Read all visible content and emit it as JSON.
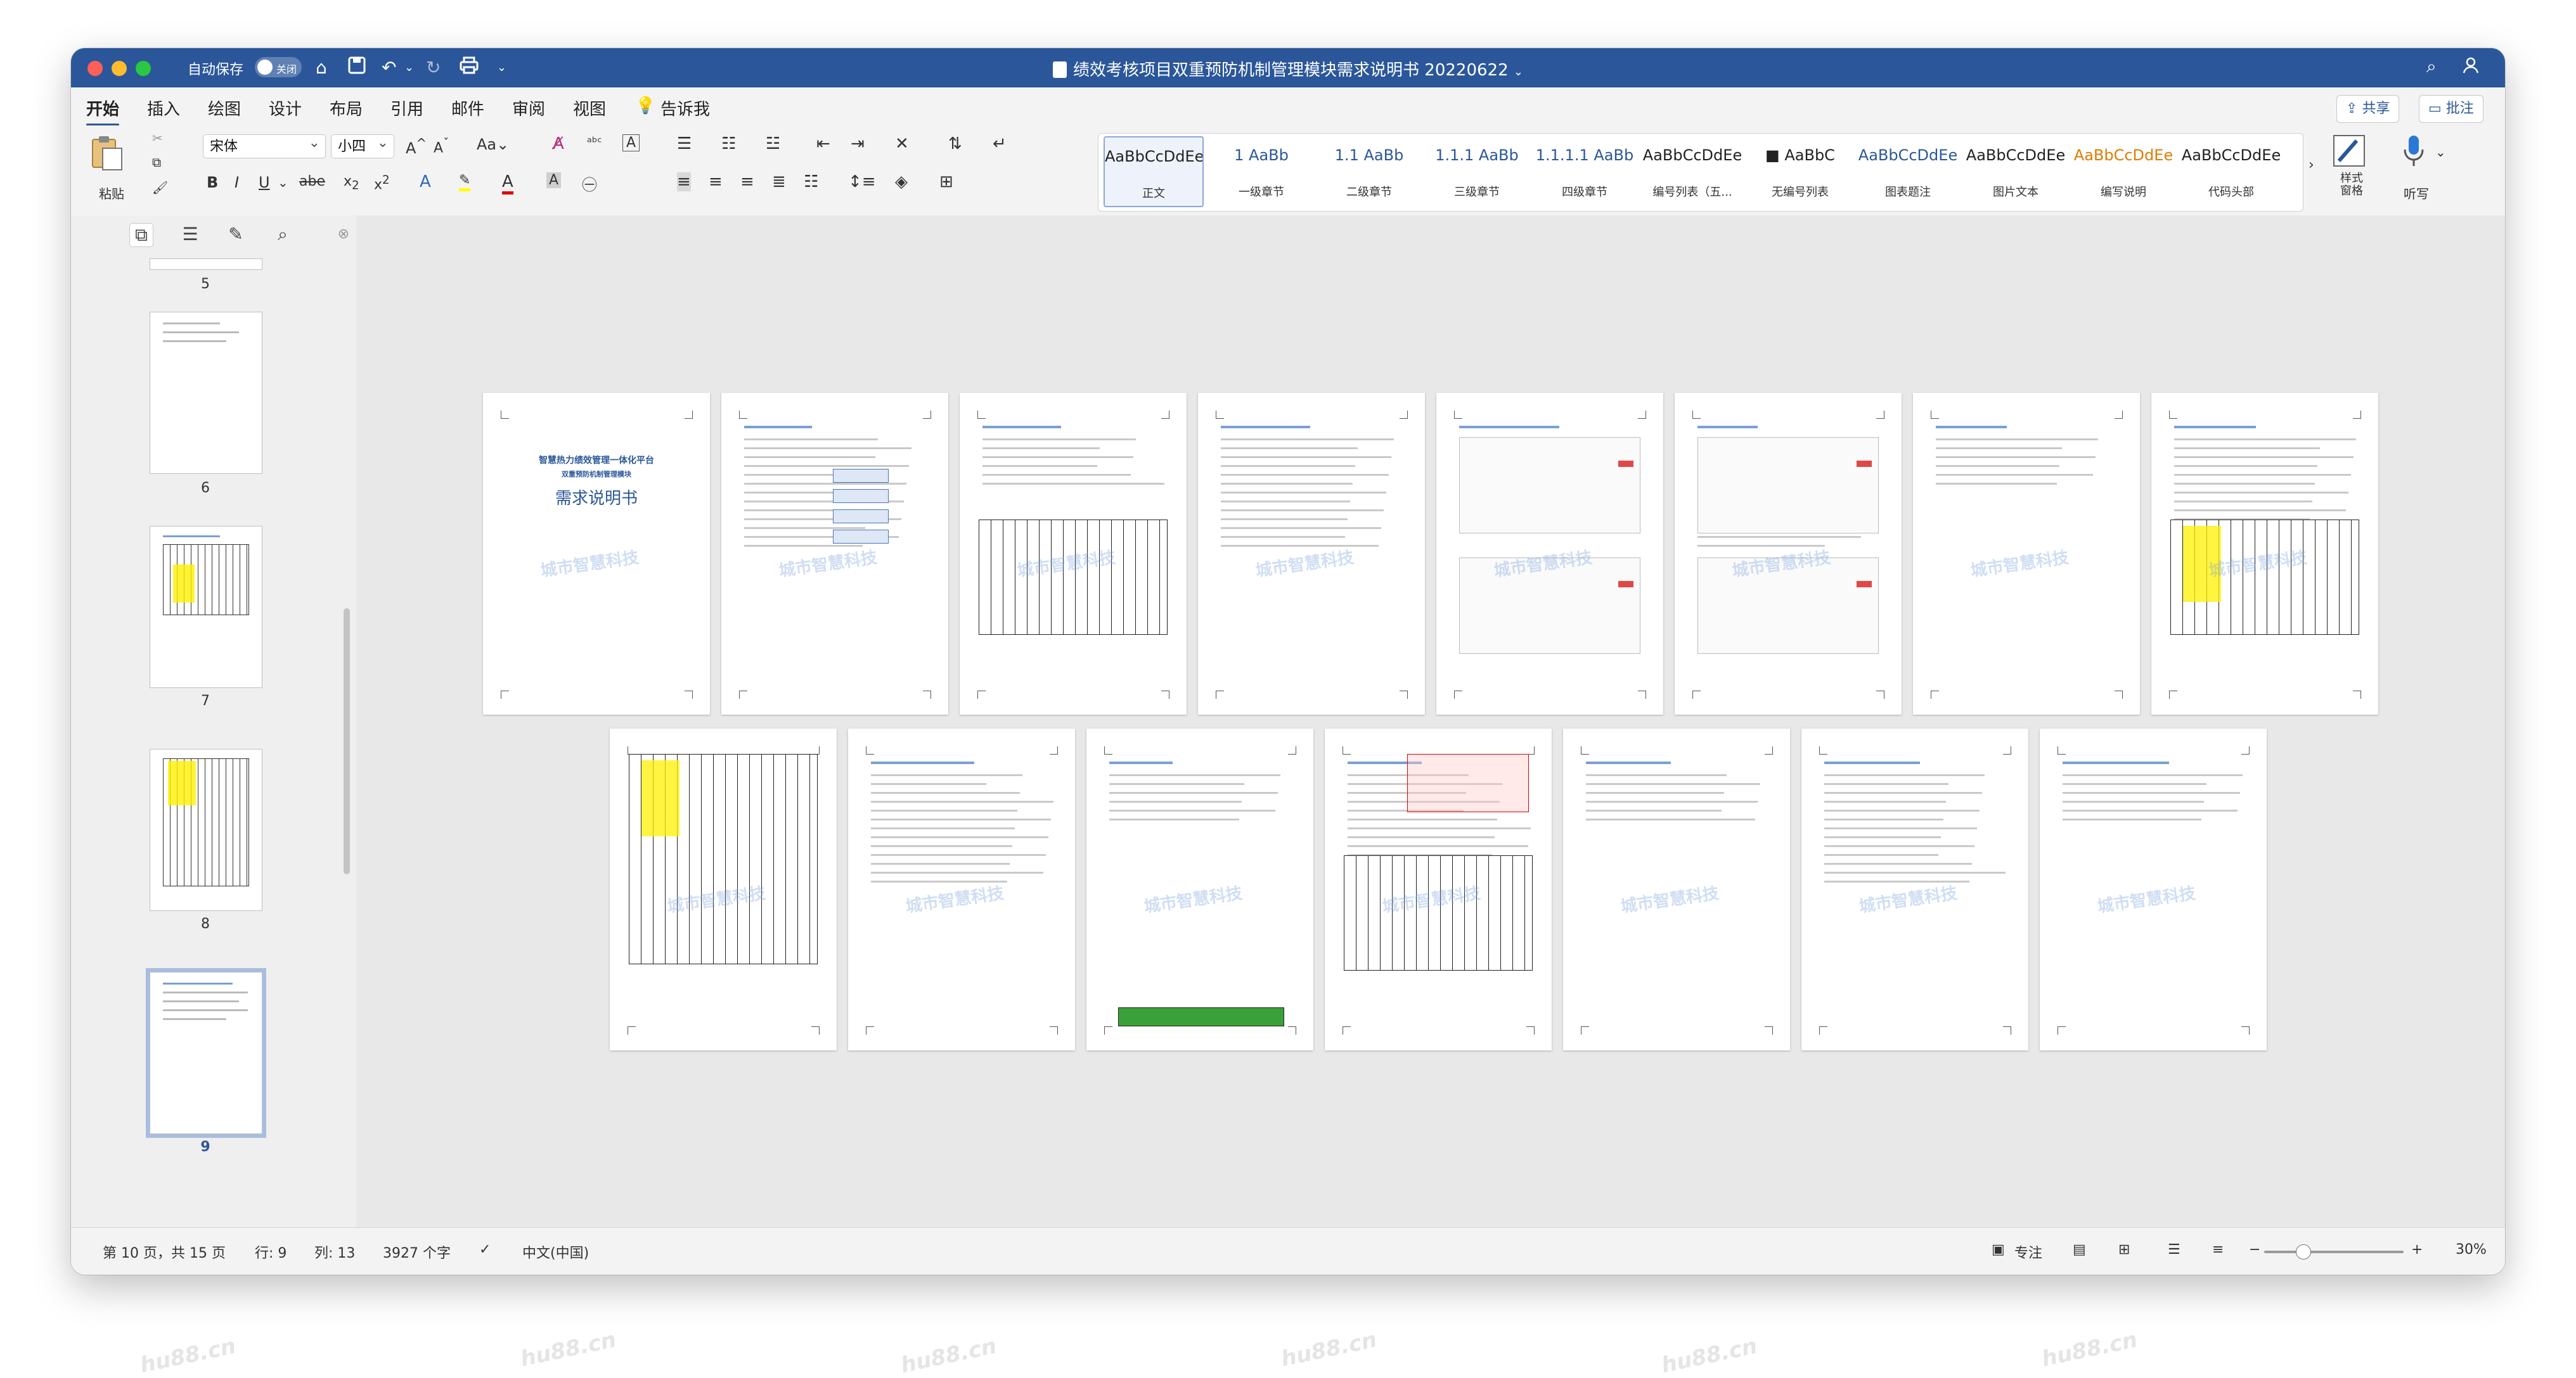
{
  "titlebar": {
    "autosave_label": "自动保存",
    "autosave_state": "关闭",
    "document_title": "绩效考核项目双重预防机制管理模块需求说明书 20220622",
    "title_chevron": "⌄"
  },
  "tabs": [
    "开始",
    "插入",
    "绘图",
    "设计",
    "布局",
    "引用",
    "邮件",
    "审阅",
    "视图",
    "告诉我"
  ],
  "active_tab": "开始",
  "share_label": "共享",
  "comment_label": "批注",
  "ribbon": {
    "paste_label": "粘贴",
    "font_name": "宋体",
    "font_size": "小四",
    "styles_pane_label": "样式\n窗格",
    "dictate_label": "听写",
    "styles": [
      {
        "sample": "AaBbCcDdEe",
        "name": "正文",
        "color": "#222222"
      },
      {
        "sample": "1 AaBb",
        "name": "一级章节",
        "color": "#2b579a"
      },
      {
        "sample": "1.1 AaBb",
        "name": "二级章节",
        "color": "#2b579a"
      },
      {
        "sample": "1.1.1 AaBb",
        "name": "三级章节",
        "color": "#2b579a"
      },
      {
        "sample": "1.1.1.1 AaBb",
        "name": "四级章节",
        "color": "#2b579a"
      },
      {
        "sample": "AaBbCcDdEe",
        "name": "编号列表（五...",
        "color": "#222222"
      },
      {
        "sample": "■ AaBbC",
        "name": "无编号列表",
        "color": "#222222"
      },
      {
        "sample": "AaBbCcDdEe",
        "name": "图表题注",
        "color": "#2b579a"
      },
      {
        "sample": "AaBbCcDdEe",
        "name": "图片文本",
        "color": "#222222"
      },
      {
        "sample": "AaBbCcDdEe",
        "name": "编写说明",
        "color": "#e07b00"
      },
      {
        "sample": "AaBbCcDdEe",
        "name": "代码头部",
        "color": "#222222"
      }
    ]
  },
  "navigation": {
    "thumbnails": [
      {
        "number": "5"
      },
      {
        "number": "6"
      },
      {
        "number": "7"
      },
      {
        "number": "8"
      },
      {
        "number": "9"
      }
    ]
  },
  "statusbar": {
    "page_info": "第 10 页，共 15 页",
    "line": "行: 9",
    "column": "列: 13",
    "word_count": "3927 个字",
    "language": "中文(中国)",
    "focus": "专注",
    "zoom": "30%"
  },
  "page_cover": {
    "title_line1": "智慧热力绩效管理一体化平台",
    "title_line2": "双重预防机制管理模块",
    "title_big": "需求说明书"
  },
  "watermark_text": "hu88.cn",
  "watermark_logo_text": "城市智慧科技"
}
